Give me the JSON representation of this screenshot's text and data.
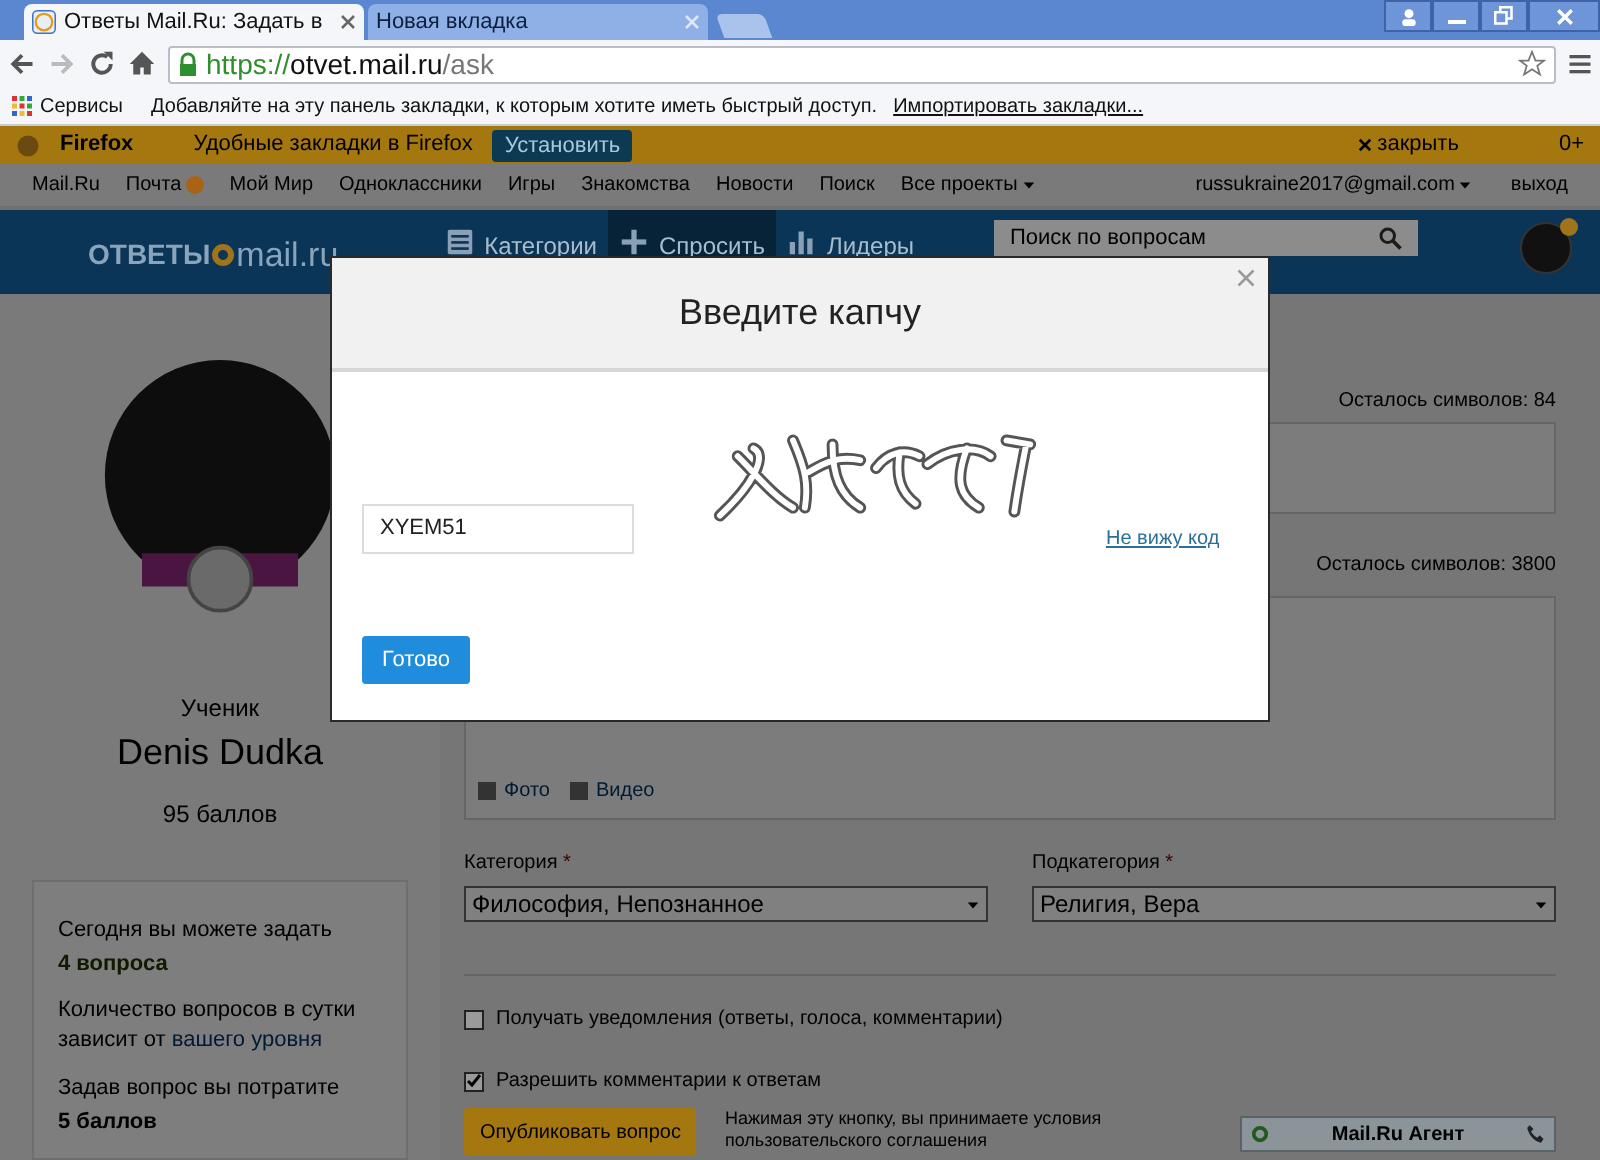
{
  "browser": {
    "tabs": [
      {
        "title": "Ответы Mail.Ru: Задать в",
        "selected": true
      },
      {
        "title": "Новая вкладка",
        "selected": false
      }
    ],
    "url": {
      "scheme": "https://",
      "host": "otvet.mail.ru",
      "path": "/ask"
    },
    "bookmarks_bar": {
      "apps": "Сервисы",
      "hint": "Добавляйте на эту панель закладки, к которым хотите иметь быстрый доступ.",
      "import_link": "Импортировать закладки..."
    }
  },
  "promo_bar": {
    "brand": "Firefox",
    "text": "Удобные закладки в Firefox",
    "button": "Установить",
    "close": "закрыть",
    "counter": "0+"
  },
  "portal_nav": {
    "items": [
      {
        "label": "Mail.Ru",
        "badge": false,
        "dropdown": false
      },
      {
        "label": "Почта",
        "badge": true,
        "dropdown": false
      },
      {
        "label": "Мой Мир",
        "badge": false,
        "dropdown": false
      },
      {
        "label": "Одноклассники",
        "badge": false,
        "dropdown": false
      },
      {
        "label": "Игры",
        "badge": false,
        "dropdown": false
      },
      {
        "label": "Знакомства",
        "badge": false,
        "dropdown": false
      },
      {
        "label": "Новости",
        "badge": false,
        "dropdown": false
      },
      {
        "label": "Поиск",
        "badge": false,
        "dropdown": false
      },
      {
        "label": "Все проекты",
        "badge": false,
        "dropdown": true
      }
    ],
    "account": "russukraine2017@gmail.com",
    "logout": "выход"
  },
  "header": {
    "logo": {
      "left": "ОТВЕТЫ",
      "right": "mail.ru"
    },
    "nav": [
      {
        "label": "Категории",
        "kind": "list",
        "selected": false
      },
      {
        "label": "Спросить",
        "kind": "plus",
        "selected": true
      },
      {
        "label": "Лидеры",
        "kind": "bars",
        "selected": false
      }
    ],
    "search": {
      "placeholder": "Поиск по вопросам"
    }
  },
  "profile": {
    "rank": "Ученик",
    "name": "Denis Dudka",
    "points": "95 баллов"
  },
  "limits": {
    "today_text": "Сегодня вы можете задать",
    "today_count": "4 вопроса",
    "level_note": "Количество вопросов в сутки зависит от",
    "level_link": "вашего уровня",
    "cost_text": "Задав вопрос вы потратите",
    "cost": "5 баллов"
  },
  "form": {
    "title_counter": "Осталось символов: 84",
    "body_counter": "Осталось символов: 3800",
    "attachments": [
      {
        "label": "Фото"
      },
      {
        "label": "Видео"
      }
    ],
    "category": {
      "label": "Категория",
      "required_mark": "*",
      "value": "Философия, Непознанное"
    },
    "subcategory": {
      "label": "Подкатегория",
      "required_mark": "*",
      "value": "Религия, Вера"
    },
    "options": [
      {
        "label": "Получать уведомления (ответы, голоса, комментарии)",
        "checked": false
      },
      {
        "label": "Разрешить комментарии к ответам",
        "checked": true
      }
    ],
    "submit": "Опубликовать вопрос",
    "terms": "Нажимая эту кнопку, вы принимаете условия пользовательского соглашения"
  },
  "agent": {
    "title": "Mail.Ru Агент"
  },
  "captcha_dialog": {
    "title": "Введите капчу",
    "input_value": "XYEM51",
    "refresh_link": "Не вижу код",
    "submit": "Готово"
  }
}
